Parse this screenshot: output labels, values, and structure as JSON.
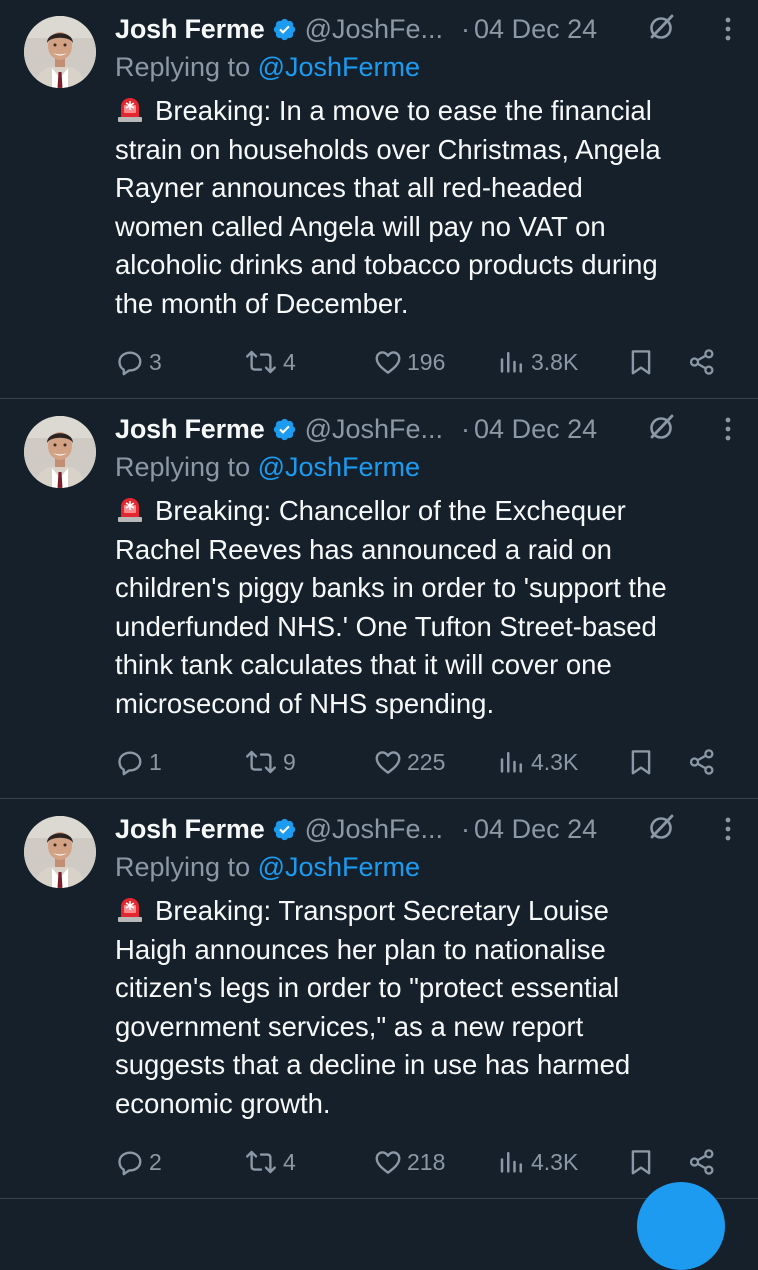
{
  "tweets": [
    {
      "author": {
        "name": "Josh Ferme",
        "handle": "@JoshFe...",
        "verified": true
      },
      "dot": "·",
      "date": "04 Dec 24",
      "replying_prefix": "Replying to",
      "replying_to": "@JoshFerme",
      "lines": [
        "Breaking: In a move to ease the financial",
        "strain on households over Christmas, Angela",
        "Rayner announces that all red-headed",
        "women called Angela will pay no VAT on",
        "alcoholic drinks and tobacco products during",
        "the month of December."
      ],
      "stats": {
        "replies": "3",
        "reposts": "4",
        "likes": "196",
        "views": "3.8K"
      }
    },
    {
      "author": {
        "name": "Josh Ferme",
        "handle": "@JoshFe...",
        "verified": true
      },
      "dot": "·",
      "date": "04 Dec 24",
      "replying_prefix": "Replying to",
      "replying_to": "@JoshFerme",
      "lines": [
        "Breaking: Chancellor of the Exchequer",
        "Rachel Reeves has announced a raid on",
        "children's piggy banks in order to 'support the",
        "underfunded NHS.' One Tufton Street-based",
        "think tank calculates that it will cover one",
        "microsecond of NHS spending."
      ],
      "stats": {
        "replies": "1",
        "reposts": "9",
        "likes": "225",
        "views": "4.3K"
      }
    },
    {
      "author": {
        "name": "Josh Ferme",
        "handle": "@JoshFe...",
        "verified": true
      },
      "dot": "·",
      "date": "04 Dec 24",
      "replying_prefix": "Replying to",
      "replying_to": "@JoshFerme",
      "lines": [
        "Breaking: Transport Secretary Louise",
        "Haigh announces her plan to nationalise",
        "citizen's legs in order to \"protect essential",
        "government services,\" as a new report",
        "suggests that a decline in use has harmed",
        "economic growth."
      ],
      "stats": {
        "replies": "2",
        "reposts": "4",
        "likes": "218",
        "views": "4.3K"
      }
    }
  ],
  "icons": {
    "verified": "verified-badge-icon",
    "siren": "police-siren-emoji",
    "grok": "grok-icon",
    "more": "more-vertical-icon",
    "reply": "reply-icon",
    "repost": "repost-icon",
    "like": "heart-icon",
    "views": "views-icon",
    "bookmark": "bookmark-icon",
    "share": "share-icon",
    "compose": "compose-fab"
  },
  "colors": {
    "background": "#15202b",
    "divider": "#38444d",
    "text": "#f7f9f9",
    "muted": "#8b98a5",
    "accent": "#1d9bf0",
    "siren_red": "#e4262e"
  }
}
